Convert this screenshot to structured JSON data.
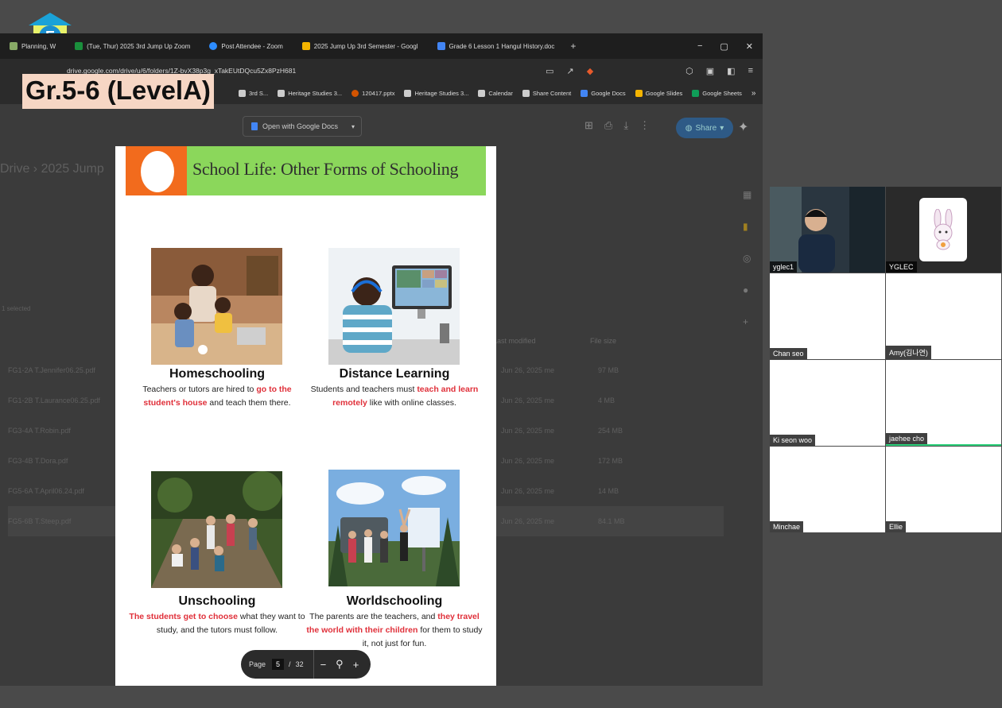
{
  "overlay": {
    "level_label": "Gr.5-6 (LevelA)"
  },
  "browser": {
    "tabs": [
      {
        "label": "Planning, W",
        "color": "#8a6"
      },
      {
        "label": "(Tue, Thur) 2025 3rd Jump Up Zoom",
        "color": "#1a8f3c"
      },
      {
        "label": "Post Attendee - Zoom",
        "color": "#2d8cff"
      },
      {
        "label": "2025 Jump Up 3rd Semester - Googl",
        "color": "#f4b400"
      },
      {
        "label": "Grade 6 Lesson 1 Hangul History.doc",
        "color": "#4285f4"
      }
    ],
    "new_tab": "+",
    "window_controls": [
      "−",
      "▢",
      "✕"
    ],
    "url": "drive.google.com/drive/u/6/folders/1Z-bvX38p3g_xTakEUtDQcu5Zx8PzH681",
    "bookmarks": [
      {
        "label": "3rd S...",
        "color": "#e8e8e8"
      },
      {
        "label": "Heritage Studies 3...",
        "color": "#e8e8e8"
      },
      {
        "label": "120417.pptx",
        "color": "#d35400"
      },
      {
        "label": "Heritage Studies 3...",
        "color": "#e8e8e8"
      },
      {
        "label": "Calendar",
        "color": "#e8e8e8"
      },
      {
        "label": "Share Content",
        "color": "#e8e8e8"
      },
      {
        "label": "Google Docs",
        "color": "#4285f4"
      },
      {
        "label": "Google Slides",
        "color": "#f4b400"
      },
      {
        "label": "Google Sheets",
        "color": "#0f9d58"
      }
    ],
    "bookmarks_more": "»"
  },
  "drive": {
    "path_root": "Drive",
    "path_folder": "2025 Jump",
    "selected_text": "1 selected",
    "column_modified": "Last modified",
    "column_size": "File size",
    "files": [
      {
        "name": "FG1-2A T.Jennifer06.25.pdf",
        "modified": "Jun 26, 2025 me",
        "size": "97 MB"
      },
      {
        "name": "FG1-2B T.Laurance06.25.pdf",
        "modified": "Jun 26, 2025 me",
        "size": "4 MB"
      },
      {
        "name": "FG3-4A T.Robin.pdf",
        "modified": "Jun 26, 2025 me",
        "size": "254 MB"
      },
      {
        "name": "FG3-4B T.Dora.pdf",
        "modified": "Jun 26, 2025 me",
        "size": "172 MB"
      },
      {
        "name": "FG5-6A T.April06.24.pdf",
        "modified": "Jun 26, 2025 me",
        "size": "14 MB"
      },
      {
        "name": "FG5-6B T.Steep.pdf",
        "modified": "Jun 26, 2025 me",
        "size": "84.1 MB"
      }
    ]
  },
  "pdf_toolbar": {
    "open_with": "Open with Google Docs",
    "share": "Share"
  },
  "pdf": {
    "header_title": "School Life: Other Forms of Schooling",
    "cards": [
      {
        "title": "Homeschooling",
        "desc_pre": "Teachers or tutors are hired to ",
        "desc_hl": "go to the student's house",
        "desc_post": " and teach them there."
      },
      {
        "title": "Distance Learning",
        "desc_pre": "Students and teachers must ",
        "desc_hl": "teach and learn remotely",
        "desc_post": " like with online classes."
      },
      {
        "title": "Unschooling",
        "desc_pre": "",
        "desc_hl": "The students get to choose",
        "desc_post": " what they want to study, and the tutors must follow."
      },
      {
        "title": "Worldschooling",
        "desc_pre": "The parents are the teachers, and ",
        "desc_hl": "they travel the world with their children",
        "desc_post": " for them to study it, not just for fun."
      }
    ],
    "nav": {
      "page_label": "Page",
      "current_page": "5",
      "separator": "/",
      "total_pages": "32",
      "zoom_out": "−",
      "zoom_icon": "⚲",
      "zoom_in": "+"
    }
  },
  "zoom_gallery": {
    "participants": [
      {
        "name": "yglec1",
        "type": "video"
      },
      {
        "name": "YGLEC",
        "type": "avatar"
      },
      {
        "name": "Chan seo",
        "type": "blank"
      },
      {
        "name": "Amy(김나연)",
        "type": "blank"
      },
      {
        "name": "Ki seon woo",
        "type": "blank"
      },
      {
        "name": "jaehee cho",
        "type": "blank"
      },
      {
        "name": "Minchae",
        "type": "blank"
      },
      {
        "name": "Ellie",
        "type": "blank"
      }
    ]
  }
}
